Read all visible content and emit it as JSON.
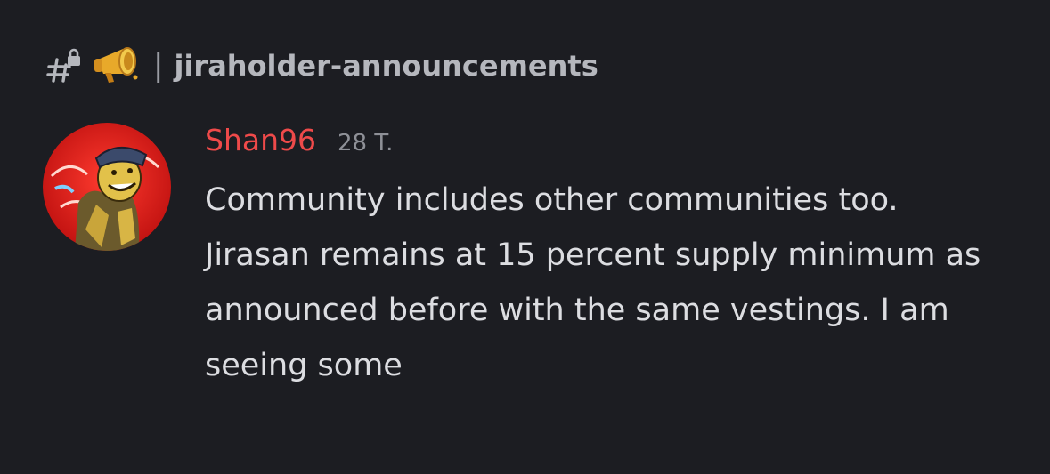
{
  "channel": {
    "prefix_icon": "locked-hash-icon",
    "emoji_icon": "megaphone-icon",
    "separator": "|",
    "name": "jiraholder-announcements"
  },
  "message": {
    "author": "Shan96",
    "author_color": "#ef4a4a",
    "timestamp": "28 T.",
    "avatar_icon": "user-avatar",
    "text": "Community includes other communities too. Jirasan remains at 15 percent supply minimum as announced before with the same vestings. I am seeing some"
  },
  "colors": {
    "background": "#1c1d22",
    "text": "#dcdde1",
    "muted": "#8e9097"
  }
}
